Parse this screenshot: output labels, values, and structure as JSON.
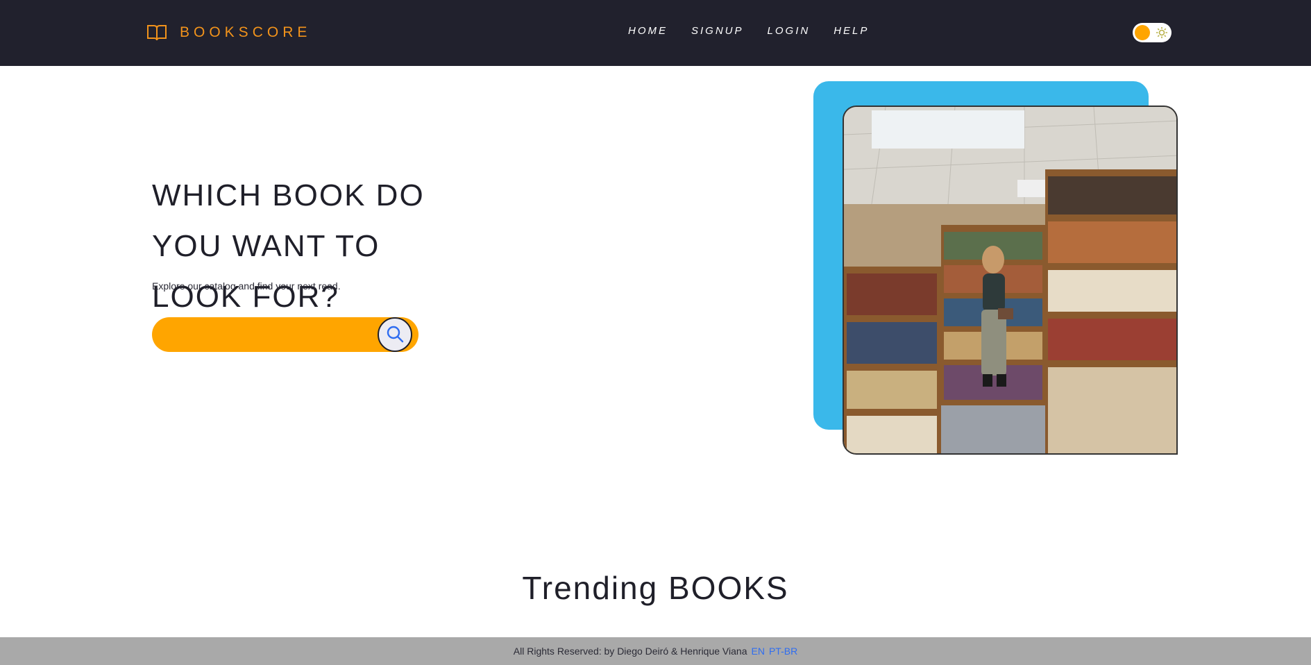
{
  "header": {
    "brand": "BOOKSCORE",
    "brand_icon": "open-book-icon",
    "nav": [
      {
        "label": "Home"
      },
      {
        "label": "Signup"
      },
      {
        "label": "Login"
      },
      {
        "label": "Help"
      }
    ],
    "theme_toggle_icon": "sun-icon"
  },
  "hero": {
    "title": "WHICH BOOK DO YOU want to LOOK for?",
    "subtitle": "Explore our catalog and find your next read.",
    "search": {
      "placeholder": "",
      "value": "",
      "button_icon": "search-icon"
    },
    "image_alt": "bookstore"
  },
  "trending": {
    "title": "Trending BOOKS"
  },
  "footer": {
    "text": "All Rights Reserved: by Diego Deiró & Henrique Viana",
    "languages": [
      {
        "label": "EN"
      },
      {
        "label": "PT-BR"
      }
    ]
  },
  "colors": {
    "header_bg": "#21212d",
    "brand": "#f2931b",
    "accent": "#ffa500",
    "blue": "#3ab8ea",
    "footer_bg": "#a9a9a9",
    "link": "#2f6df0"
  }
}
